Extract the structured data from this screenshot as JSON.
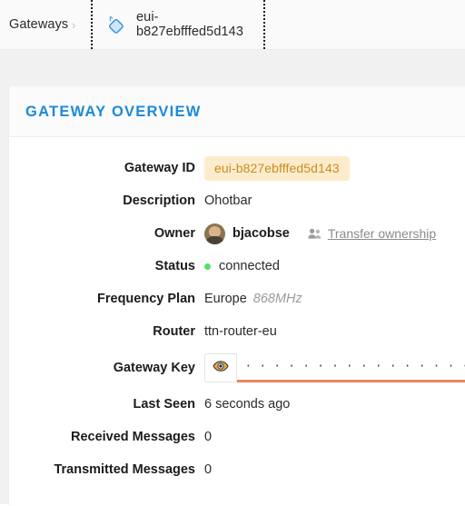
{
  "breadcrumb": {
    "root_label": "Gateways",
    "separator": "›",
    "tab_label": "eui-b827ebfffed5d143",
    "tab_icon": "gateway-diamond-icon"
  },
  "card": {
    "title": "GATEWAY OVERVIEW",
    "accent_color": "#1c8ad8",
    "rows": [
      {
        "label": "Gateway ID",
        "value": "eui-b827ebfffed5d143",
        "style": "pill",
        "pill_bg": "#fdeccb",
        "pill_fg": "#c98b22"
      },
      {
        "label": "Description",
        "value": "Ohotbar",
        "style": "plain"
      },
      {
        "label": "Owner",
        "value": "bjacobse",
        "style": "owner"
      },
      {
        "label": "Status",
        "value": "connected",
        "style": "status",
        "status_color": "#55e06a"
      },
      {
        "label": "Frequency Plan",
        "value": "Europe",
        "extra": "868MHz",
        "style": "frequency"
      },
      {
        "label": "Router",
        "value": "ttn-router-eu",
        "style": "plain"
      },
      {
        "label": "Gateway Key",
        "value": "· · · · · · · · · · · · · · · · · · · · · · · · · · · · · · · · · · · · · · · ·",
        "style": "key",
        "underline_color": "#e8875a"
      },
      {
        "label": "Last Seen",
        "value": "6 seconds ago",
        "style": "plain"
      },
      {
        "label": "Received Messages",
        "value": "0",
        "style": "plain"
      },
      {
        "label": "Transmitted Messages",
        "value": "0",
        "style": "plain"
      }
    ],
    "owner": {
      "avatar_icon": "user-avatar",
      "name": "bjacobse",
      "transfer_label": "Transfer ownership",
      "transfer_icon": "people-icon"
    },
    "key_field": {
      "reveal_icon": "eye-icon"
    }
  }
}
